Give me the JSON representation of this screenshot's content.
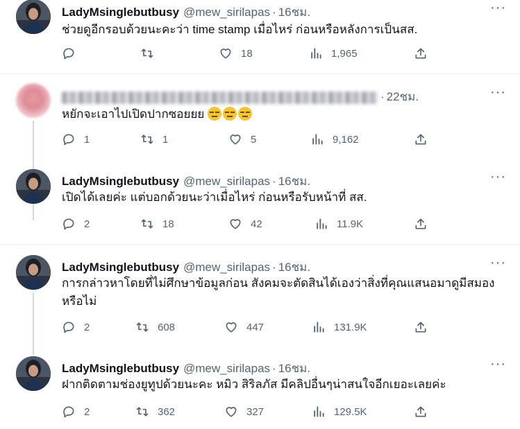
{
  "tweets": [
    {
      "name": "LadyMsinglebutbusy",
      "handle": "@mew_sirilapas",
      "time": "16ชม.",
      "text": "ช่วยดูอีกรอบด้วยนะคะว่า time stamp เมื่อไหร่ ก่อนหรือหลังการเป็นสส.",
      "reply": "",
      "retweet": "",
      "like": "18",
      "views": "1,965"
    },
    {
      "name": "",
      "handle": "",
      "time": "22ชม.",
      "text": "หยักจะเอาไปเปิดปากซอยยย",
      "reply": "1",
      "retweet": "1",
      "like": "5",
      "views": "9,162"
    },
    {
      "name": "LadyMsinglebutbusy",
      "handle": "@mew_sirilapas",
      "time": "16ชม.",
      "text": "เปิดได้เลยค่ะ  แต่บอกด้วยนะว่าเมื่อไหร่ ก่อนหรือรับหน้าที่ สส.",
      "reply": "2",
      "retweet": "18",
      "like": "42",
      "views": "11.9K"
    },
    {
      "name": "LadyMsinglebutbusy",
      "handle": "@mew_sirilapas",
      "time": "16ชม.",
      "text": "การกล่าวหาโดยที่ไม่ศึกษาข้อมูลก่อน สังคมจะตัดสินได้เองว่าสิ่งที่คุณแสนอมาดูมีสมองหรือไม่",
      "reply": "2",
      "retweet": "608",
      "like": "447",
      "views": "131.9K"
    },
    {
      "name": "LadyMsinglebutbusy",
      "handle": "@mew_sirilapas",
      "time": "16ชม.",
      "text": "ฝากติดตามช่องยูทูปด้วยนะคะ หมิว สิริลภัส มีคลิปอื่นๆน่าสนใจอีกเยอะเลยค่ะ",
      "reply": "2",
      "retweet": "362",
      "like": "327",
      "views": "129.5K"
    }
  ],
  "more_glyph": "···",
  "dot": "·",
  "icons": [
    "reply-icon",
    "retweet-icon",
    "like-icon",
    "views-icon",
    "share-icon",
    "more-icon"
  ]
}
